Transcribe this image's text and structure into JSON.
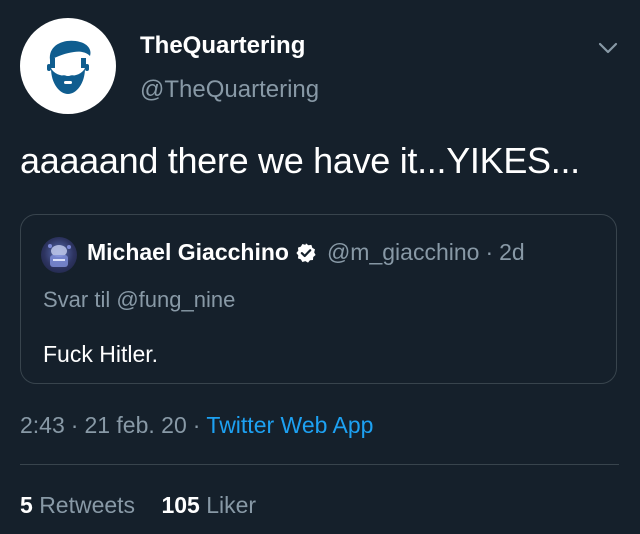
{
  "author": {
    "name": "TheQuartering",
    "handle": "@TheQuartering",
    "avatar_icon": "bearded-man-icon"
  },
  "menu_icon": "chevron-down-icon",
  "tweet": {
    "text": "aaaaand there we have it...YIKES..."
  },
  "quoted_tweet": {
    "name": "Michael Giacchino",
    "verified_icon": "verified-badge-icon",
    "handle": "@m_giacchino",
    "separator": "·",
    "time": "2d",
    "reply_to": "Svar til @fung_nine",
    "text": "Fuck Hitler."
  },
  "meta": {
    "time": "2:43",
    "separator": "·",
    "date": "21 feb. 20",
    "source": "Twitter Web App"
  },
  "stats": {
    "retweets_count": "5",
    "retweets_label": "Retweets",
    "likes_count": "105",
    "likes_label": "Liker"
  },
  "colors": {
    "background": "#15202b",
    "text": "#ffffff",
    "muted": "#8899a6",
    "accent": "#1da1f2",
    "border": "#38444d"
  }
}
